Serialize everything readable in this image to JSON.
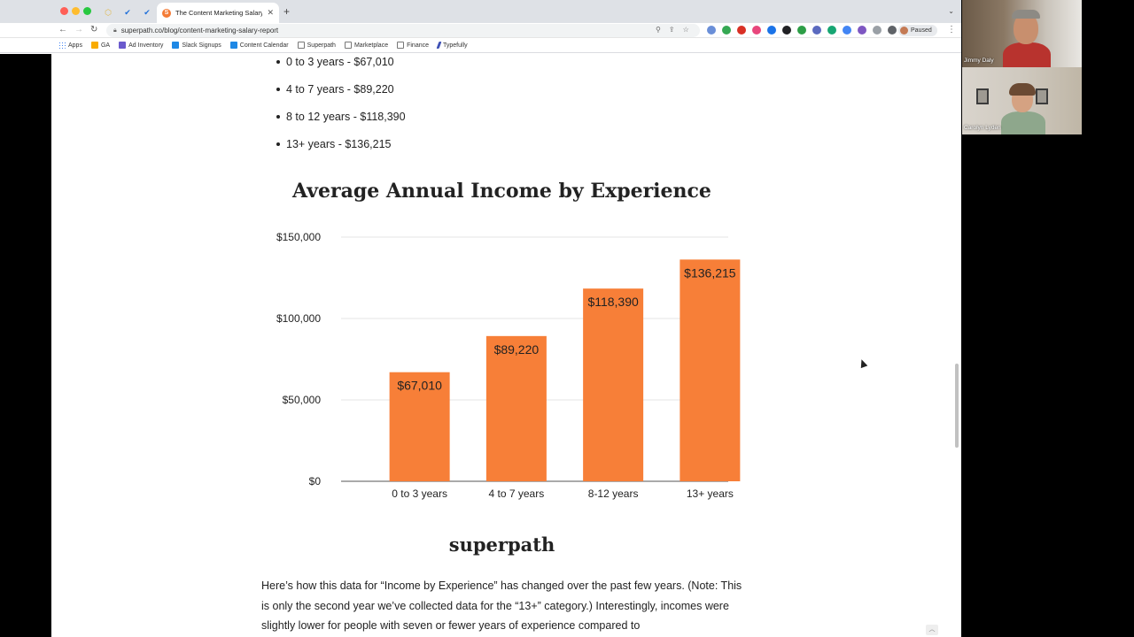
{
  "browser": {
    "tab_title": "The Content Marketing Salary",
    "tab_favicon": "S",
    "url": "superpath.co/blog/content-marketing-salary-report",
    "paused_label": "Paused",
    "bookmarks": [
      {
        "label": "Apps",
        "color": "#4285f4"
      },
      {
        "label": "GA",
        "color": "#f9ab00"
      },
      {
        "label": "Ad Inventory",
        "color": "#6a5acd"
      },
      {
        "label": "Slack Signups",
        "color": "#1e88e5"
      },
      {
        "label": "Content Calendar",
        "color": "#1e88e5"
      },
      {
        "label": "Superpath",
        "color": "#9e9e9e"
      },
      {
        "label": "Marketplace",
        "color": "#9e9e9e"
      },
      {
        "label": "Finance",
        "color": "#9e9e9e"
      },
      {
        "label": "Typefully",
        "color": "#3f51b5"
      }
    ]
  },
  "article": {
    "bullets": [
      "0 to 3 years - $67,010",
      "4 to 7 years - $89,220",
      "8 to 12 years - $118,390",
      "13+ years - $136,215"
    ],
    "brand": "superpath",
    "paragraph": "Here’s how this data for “Income by Experience” has changed over the past few years. (Note: This is only the second year we’ve collected data for the “13+” category.) Interestingly, incomes were slightly lower for people with seven or fewer years of experience compared to"
  },
  "chart_data": {
    "type": "bar",
    "title": "Average Annual Income by Experience",
    "categories": [
      "0 to 3 years",
      "4 to 7 years",
      "8-12 years",
      "13+ years"
    ],
    "values": [
      67010,
      89220,
      118390,
      136215
    ],
    "value_labels": [
      "$67,010",
      "$89,220",
      "$118,390",
      "$136,215"
    ],
    "y_ticks": [
      0,
      50000,
      100000,
      150000
    ],
    "y_tick_labels": [
      "$0",
      "$50,000",
      "$100,000",
      "$150,000"
    ],
    "ylim": [
      0,
      150000
    ],
    "bar_color": "#f77f38",
    "grid": true,
    "legend": "none"
  },
  "video": {
    "participants": [
      "Jimmy Daly",
      "Carolyn Lyden"
    ]
  }
}
